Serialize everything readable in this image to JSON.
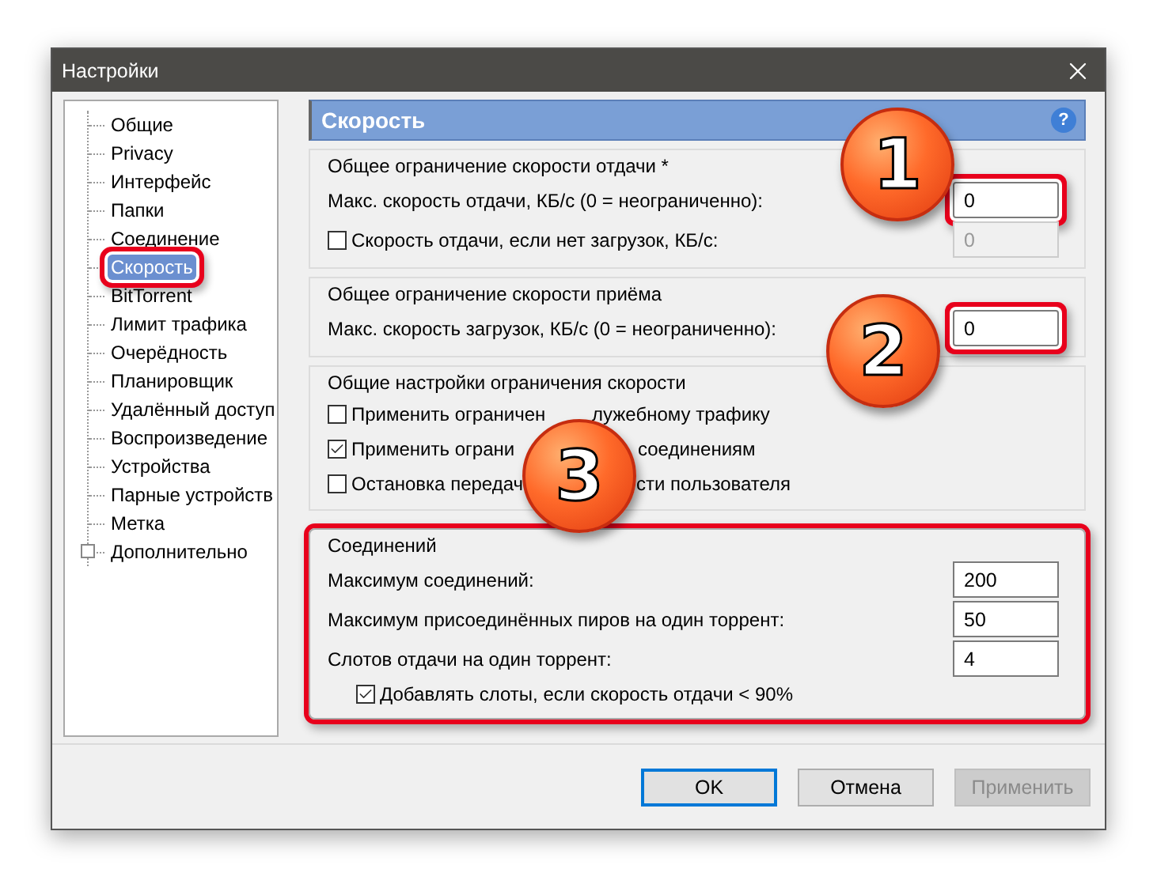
{
  "window": {
    "title": "Настройки"
  },
  "sidebar": {
    "items": [
      {
        "label": "Общие",
        "kind": "leaf",
        "selected": false,
        "highlighted": false
      },
      {
        "label": "Privacy",
        "kind": "leaf",
        "selected": false,
        "highlighted": false
      },
      {
        "label": "Интерфейс",
        "kind": "leaf",
        "selected": false,
        "highlighted": false
      },
      {
        "label": "Папки",
        "kind": "leaf",
        "selected": false,
        "highlighted": false
      },
      {
        "label": "Соединение",
        "kind": "leaf",
        "selected": false,
        "highlighted": false
      },
      {
        "label": "Скорость",
        "kind": "leaf",
        "selected": true,
        "highlighted": true
      },
      {
        "label": "BitTorrent",
        "kind": "leaf",
        "selected": false,
        "highlighted": false
      },
      {
        "label": "Лимит трафика",
        "kind": "leaf",
        "selected": false,
        "highlighted": false
      },
      {
        "label": "Очерёдность",
        "kind": "leaf",
        "selected": false,
        "highlighted": false
      },
      {
        "label": "Планировщик",
        "kind": "leaf",
        "selected": false,
        "highlighted": false
      },
      {
        "label": "Удалённый доступ",
        "kind": "leaf",
        "selected": false,
        "highlighted": false
      },
      {
        "label": "Воспроизведение",
        "kind": "leaf",
        "selected": false,
        "highlighted": false
      },
      {
        "label": "Устройства",
        "kind": "leaf",
        "selected": false,
        "highlighted": false
      },
      {
        "label": "Парные устройств",
        "kind": "leaf",
        "selected": false,
        "highlighted": false
      },
      {
        "label": "Метка",
        "kind": "leaf",
        "selected": false,
        "highlighted": false
      },
      {
        "label": "Дополнительно",
        "kind": "folder",
        "selected": false,
        "highlighted": false
      }
    ]
  },
  "panel": {
    "title": "Скорость",
    "help": "?",
    "groups": [
      {
        "title": "Общее ограничение скорости отдачи *",
        "highlighted": false,
        "rows": [
          {
            "kind": "field",
            "label": "Макс. скорость отдачи, КБ/с (0 = неограниченно):",
            "value": "0",
            "highlighted": true,
            "disabled": false
          },
          {
            "kind": "check-field",
            "label": "Скорость отдачи, если нет загрузок, КБ/с:",
            "checked": false,
            "value": "0",
            "highlighted": false,
            "disabled": true
          }
        ]
      },
      {
        "title": "Общее ограничение скорости приёма",
        "highlighted": false,
        "rows": [
          {
            "kind": "field",
            "label": "Макс. скорость загрузок, КБ/с (0 = неограниченно):",
            "value": "0",
            "highlighted": true,
            "disabled": false
          }
        ]
      },
      {
        "title": "Общие настройки ограничения скорости",
        "highlighted": false,
        "rows": [
          {
            "kind": "check-covered",
            "parts": [
              "Применить ограничен",
              "лужебному трафику"
            ],
            "checked": false
          },
          {
            "kind": "check-covered",
            "parts": [
              "Применить ограни",
              "соединениям"
            ],
            "checked": true
          },
          {
            "kind": "check-covered",
            "parts": [
              "Остановка передач",
              "сти пользователя"
            ],
            "checked": false
          }
        ]
      },
      {
        "title": "Соединений",
        "highlighted": true,
        "rows": [
          {
            "kind": "field",
            "label": "Максимум соединений:",
            "value": "200",
            "highlighted": false,
            "disabled": false
          },
          {
            "kind": "field",
            "label": "Максимум присоединённых пиров на один торрент:",
            "value": "50",
            "highlighted": false,
            "disabled": false
          },
          {
            "kind": "field",
            "label": "Слотов отдачи на один торрент:",
            "value": "4",
            "highlighted": false,
            "disabled": false
          },
          {
            "kind": "subcheck",
            "label": "Добавлять слоты, если скорость отдачи < 90%",
            "checked": true
          }
        ]
      }
    ]
  },
  "callouts": [
    "1",
    "2",
    "3"
  ],
  "buttons": [
    {
      "label": "OK",
      "default": true,
      "disabled": false
    },
    {
      "label": "Отмена",
      "default": false,
      "disabled": false
    },
    {
      "label": "Применить",
      "default": false,
      "disabled": true
    }
  ]
}
